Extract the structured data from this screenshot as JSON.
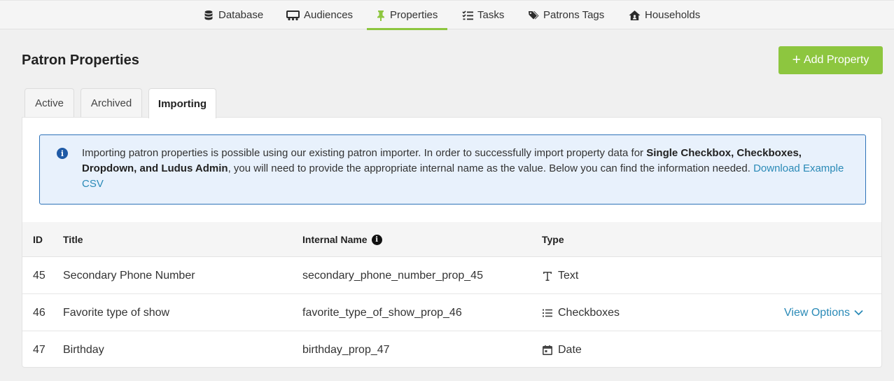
{
  "nav": {
    "items": [
      {
        "label": "Database",
        "icon": "database-icon"
      },
      {
        "label": "Audiences",
        "icon": "audiences-icon"
      },
      {
        "label": "Properties",
        "icon": "pushpin-icon",
        "active": true
      },
      {
        "label": "Tasks",
        "icon": "tasks-icon"
      },
      {
        "label": "Patrons Tags",
        "icon": "tags-icon"
      },
      {
        "label": "Households",
        "icon": "house-icon"
      }
    ]
  },
  "page": {
    "title": "Patron Properties",
    "add_button": "Add Property"
  },
  "tabs": [
    {
      "label": "Active"
    },
    {
      "label": "Archived"
    },
    {
      "label": "Importing",
      "active": true
    }
  ],
  "info": {
    "text_1": "Importing patron properties is possible using our existing patron importer. In order to successfully import property data for ",
    "bold": "Single Checkbox, Checkboxes, Dropdown, and Ludus Admin",
    "text_2": ", you will need to provide the appropriate internal name as the value. Below you can find the information needed. ",
    "link": "Download Example CSV"
  },
  "table": {
    "headers": {
      "id": "ID",
      "title": "Title",
      "internal_name": "Internal Name",
      "type": "Type"
    },
    "rows": [
      {
        "id": "45",
        "title": "Secondary Phone Number",
        "internal_name": "secondary_phone_number_prop_45",
        "type": "Text",
        "type_icon": "text-icon"
      },
      {
        "id": "46",
        "title": "Favorite type of show",
        "internal_name": "favorite_type_of_show_prop_46",
        "type": "Checkboxes",
        "type_icon": "list-icon",
        "action": "View Options"
      },
      {
        "id": "47",
        "title": "Birthday",
        "internal_name": "birthday_prop_47",
        "type": "Date",
        "type_icon": "calendar-icon"
      }
    ]
  },
  "colors": {
    "accent_green": "#8dc63f",
    "link_blue": "#2a8ab7",
    "info_border": "#2d72b8",
    "info_bg": "#e8f1fc"
  }
}
